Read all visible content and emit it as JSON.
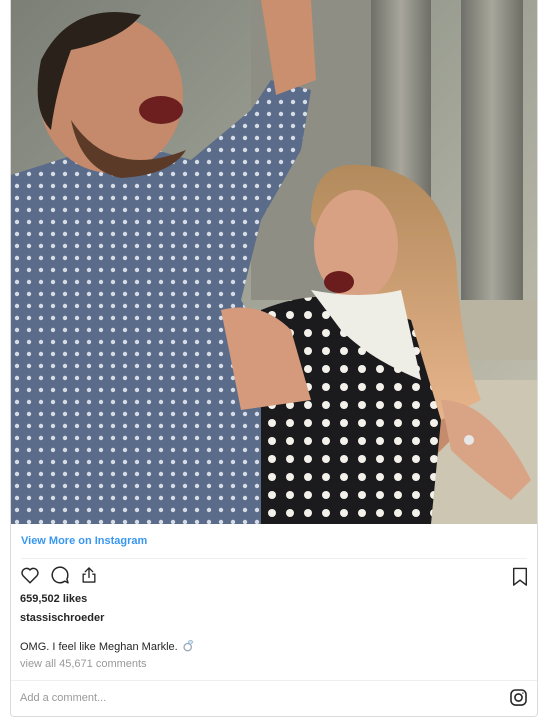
{
  "post": {
    "view_more_label": "View More on Instagram",
    "likes_text": "659,502 likes",
    "username": "stassischroeder",
    "caption_text": "OMG. I feel like Meghan Markle.",
    "caption_emoji_icon": "ring-icon",
    "view_comments_text": "view all 45,671 comments",
    "add_comment_placeholder": "Add a comment..."
  },
  "icons": {
    "like": "heart-icon",
    "comment": "comment-bubble-icon",
    "share": "share-icon",
    "save": "bookmark-icon",
    "brand": "instagram-logo-icon"
  },
  "colors": {
    "link": "#3897f0",
    "text": "#262626",
    "muted": "#999999",
    "border": "#dbdbdb"
  }
}
